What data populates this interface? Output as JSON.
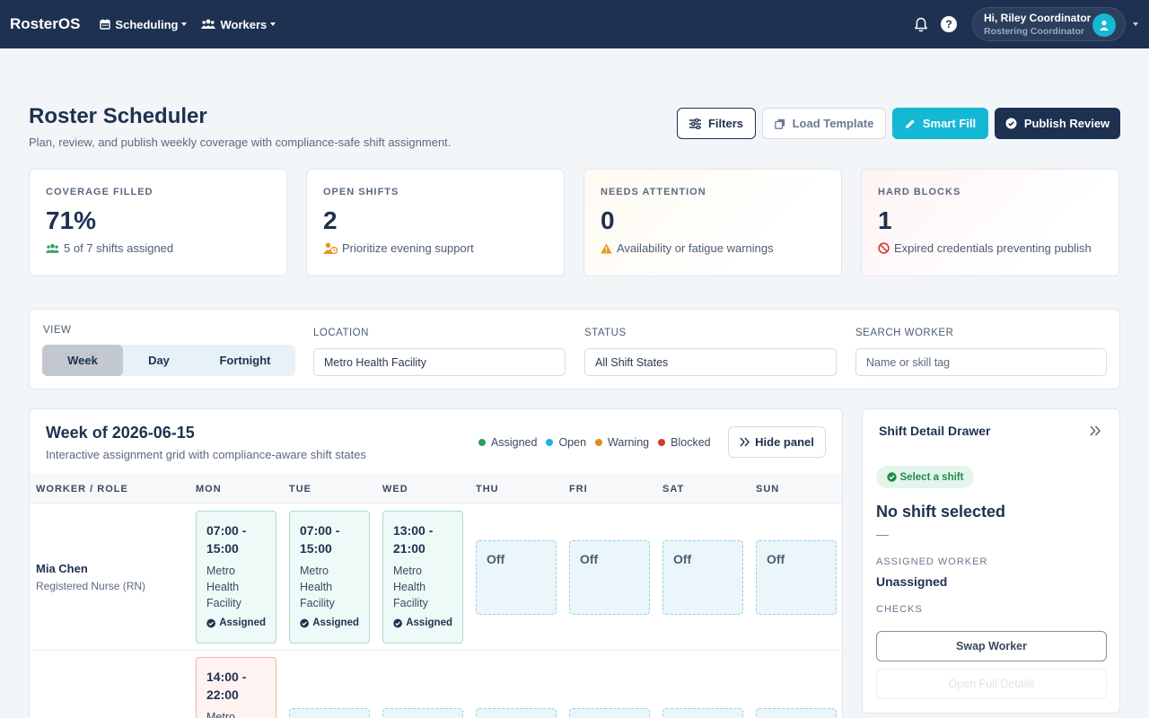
{
  "nav": {
    "brand": "RosterOS",
    "menus": [
      {
        "label": "Scheduling",
        "icon": "calendar-icon"
      },
      {
        "label": "Workers",
        "icon": "users-icon"
      }
    ],
    "user": {
      "greeting": "Hi, Riley Coordinator",
      "role": "Rostering Coordinator"
    }
  },
  "header": {
    "title": "Roster Scheduler",
    "subtitle": "Plan, review, and publish weekly coverage with compliance-safe shift assignment.",
    "actions": {
      "filters": "Filters",
      "load_template": "Load Template",
      "smart_fill": "Smart Fill",
      "publish_review": "Publish Review"
    }
  },
  "stats": [
    {
      "label": "COVERAGE FILLED",
      "value": "71%",
      "note": "5 of 7 shifts assigned",
      "icon": "users-icon",
      "color": "#2e9e5e"
    },
    {
      "label": "OPEN SHIFTS",
      "value": "2",
      "note": "Prioritize evening support",
      "icon": "user-clock-icon",
      "color": "#e39b1f"
    },
    {
      "label": "NEEDS ATTENTION",
      "value": "0",
      "note": "Availability or fatigue warnings",
      "icon": "warning-icon",
      "color": "#e39b1f"
    },
    {
      "label": "HARD BLOCKS",
      "value": "1",
      "note": "Expired credentials preventing publish",
      "icon": "ban-icon",
      "color": "#d63a2f"
    }
  ],
  "filters": {
    "view_label": "VIEW",
    "views": [
      "Week",
      "Day",
      "Fortnight"
    ],
    "active_view": "Week",
    "location_label": "LOCATION",
    "location_value": "Metro Health Facility",
    "status_label": "STATUS",
    "status_value": "All Shift States",
    "search_label": "SEARCH WORKER",
    "search_placeholder": "Name or skill tag"
  },
  "grid": {
    "title": "Week of 2026-06-15",
    "subtitle": "Interactive assignment grid with compliance-aware shift states",
    "legend": [
      {
        "label": "Assigned",
        "color": "#2e9e5e"
      },
      {
        "label": "Open",
        "color": "#14b8d4"
      },
      {
        "label": "Warning",
        "color": "#e38a1f"
      },
      {
        "label": "Blocked",
        "color": "#d63a2f"
      }
    ],
    "hide_panel": "Hide panel",
    "worker_header": "WORKER / ROLE",
    "days": [
      "MON",
      "TUE",
      "WED",
      "THU",
      "FRI",
      "SAT",
      "SUN"
    ],
    "rows": [
      {
        "name": "Mia Chen",
        "role": "Registered Nurse (RN)",
        "cells": [
          {
            "time1": "07:00 -",
            "time2": "15:00",
            "loc": [
              "Metro",
              "Health",
              "Facility"
            ],
            "status": "Assigned"
          },
          {
            "time1": "07:00 -",
            "time2": "15:00",
            "loc": [
              "Metro",
              "Health",
              "Facility"
            ],
            "status": "Assigned"
          },
          {
            "time1": "13:00 -",
            "time2": "21:00",
            "loc": [
              "Metro",
              "Health",
              "Facility"
            ],
            "status": "Assigned"
          },
          {
            "off": "Off"
          },
          {
            "off": "Off"
          },
          {
            "off": "Off"
          },
          {
            "off": "Off"
          }
        ]
      },
      {
        "cells": [
          {
            "time1": "14:00 -",
            "time2": "22:00",
            "loc": [
              "Metro"
            ]
          }
        ]
      }
    ]
  },
  "drawer": {
    "title": "Shift Detail Drawer",
    "pill": "Select a shift",
    "heading": "No shift selected",
    "dash": "—",
    "assigned_label": "ASSIGNED WORKER",
    "assigned_value": "Unassigned",
    "checks_label": "CHECKS",
    "swap": "Swap Worker",
    "open_full": "Open Full Details"
  }
}
